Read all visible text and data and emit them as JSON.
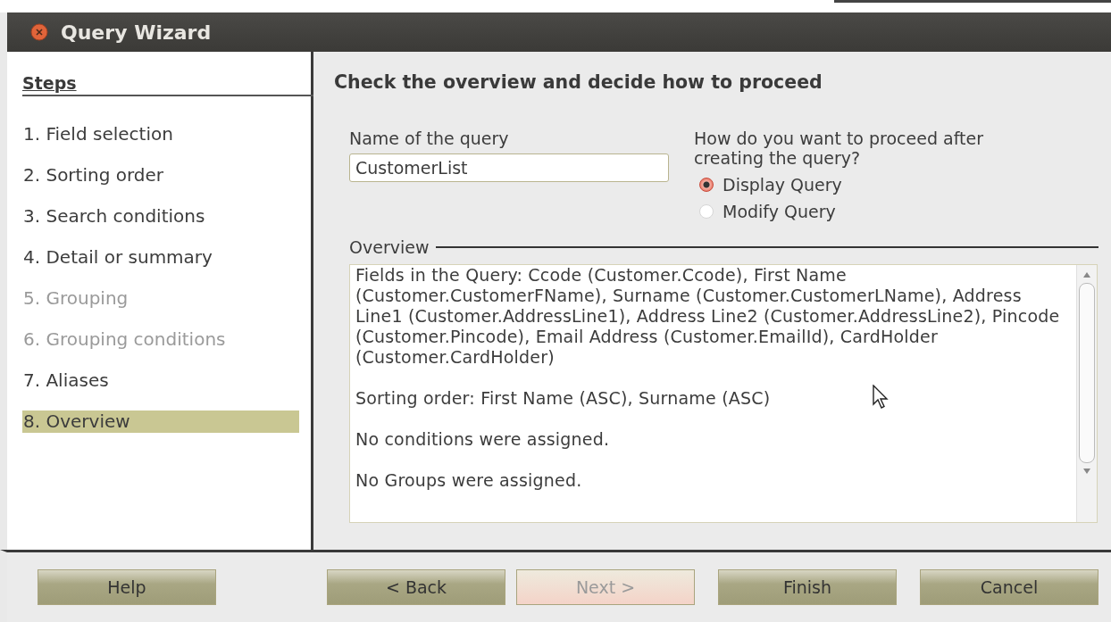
{
  "window": {
    "title": "Query Wizard"
  },
  "steps": {
    "heading": "Steps",
    "items": [
      {
        "label": "1. Field selection",
        "disabled": false,
        "selected": false
      },
      {
        "label": "2. Sorting order",
        "disabled": false,
        "selected": false
      },
      {
        "label": "3. Search conditions",
        "disabled": false,
        "selected": false
      },
      {
        "label": "4. Detail or summary",
        "disabled": false,
        "selected": false
      },
      {
        "label": "5. Grouping",
        "disabled": true,
        "selected": false
      },
      {
        "label": "6. Grouping conditions",
        "disabled": true,
        "selected": false
      },
      {
        "label": "7. Aliases",
        "disabled": false,
        "selected": false
      },
      {
        "label": "8. Overview",
        "disabled": false,
        "selected": true
      }
    ]
  },
  "page": {
    "title": "Check the overview and decide how to proceed",
    "name_field": {
      "label": "Name of the query",
      "value": "CustomerList"
    },
    "proceed": {
      "label": "How do you want to proceed after creating the query?",
      "options": [
        {
          "label": "Display Query",
          "selected": true
        },
        {
          "label": "Modify Query",
          "selected": false
        }
      ]
    },
    "overview": {
      "label": "Overview",
      "paragraphs": [
        "Fields in the Query: Ccode (Customer.Ccode), First Name (Customer.CustomerFName), Surname (Customer.CustomerLName), Address Line1 (Customer.AddressLine1), Address Line2 (Customer.AddressLine2), Pincode (Customer.Pincode), Email Address (Customer.EmailId), CardHolder (Customer.CardHolder)",
        "Sorting order: First Name (ASC), Surname (ASC)",
        "No conditions were assigned.",
        "No Groups were assigned."
      ]
    }
  },
  "buttons": [
    {
      "label": "Help",
      "disabled": false
    },
    {
      "label": "< Back",
      "disabled": false
    },
    {
      "label": "Next >",
      "disabled": true
    },
    {
      "label": "Finish",
      "disabled": false
    },
    {
      "label": "Cancel",
      "disabled": false
    }
  ]
}
